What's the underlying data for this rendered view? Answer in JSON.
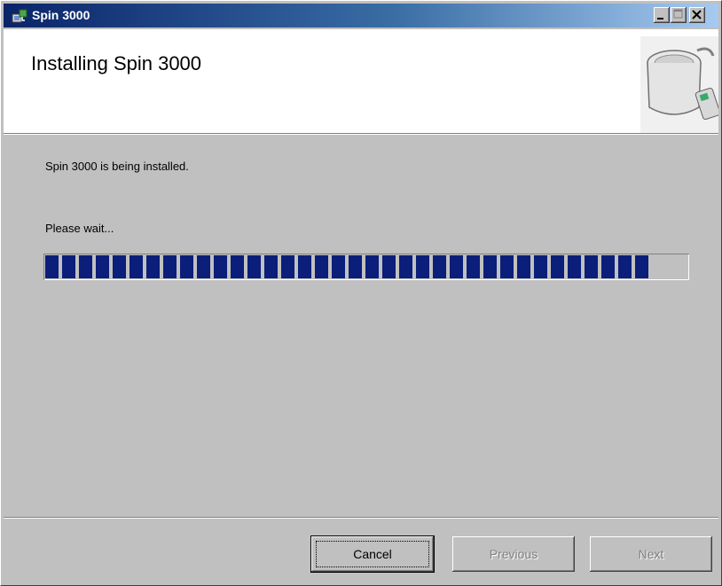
{
  "window": {
    "title": "Spin 3000",
    "icon": "installer-app-icon",
    "controls": [
      "minimize-icon",
      "maximize-icon",
      "close-icon"
    ]
  },
  "header": {
    "title": "Installing Spin 3000",
    "image": "spin-3000-product-image"
  },
  "main": {
    "status": "Spin 3000 is being installed.",
    "wait_label": "Please wait...",
    "progress": 0.94
  },
  "footer": {
    "cancel_label": "Cancel",
    "previous_label": "Previous",
    "next_label": "Next"
  },
  "colors": {
    "titlebar_start": "#0a246a",
    "titlebar_end": "#a6caf0",
    "progress_block": "#0a1e7a",
    "face": "#c0c0c0"
  }
}
